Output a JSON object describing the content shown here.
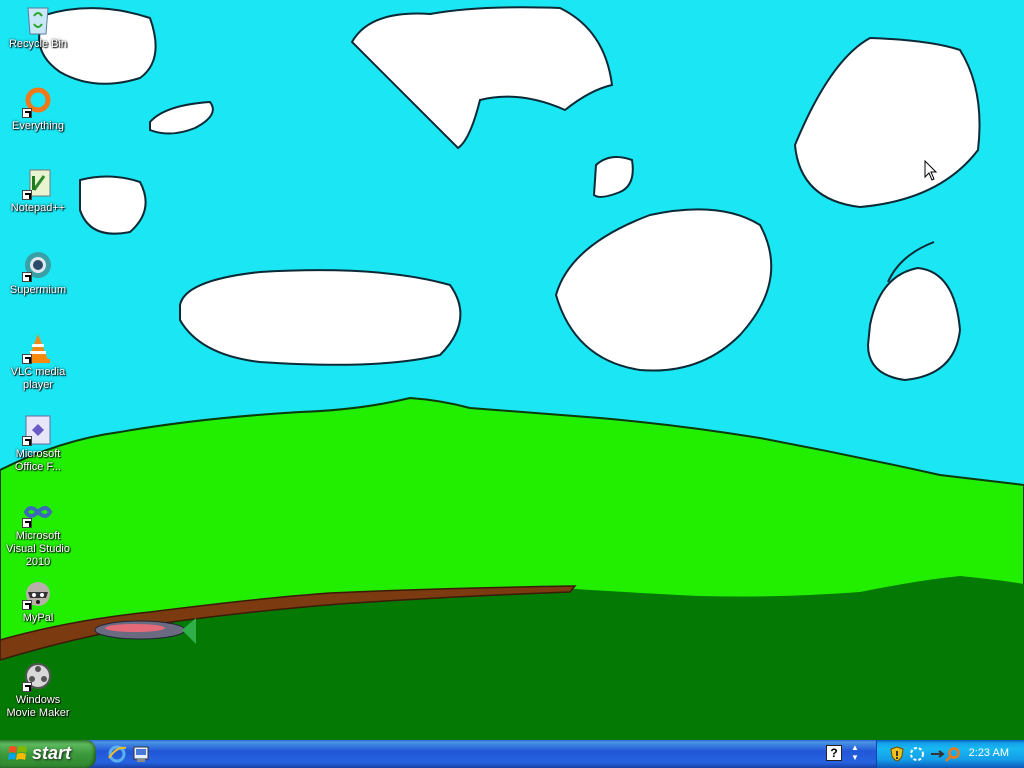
{
  "desktop": {
    "icons": [
      {
        "label": "Recycle Bin",
        "icon": "recycle-bin-icon"
      },
      {
        "label": "Everything",
        "icon": "everything-search-icon"
      },
      {
        "label": "Notepad++",
        "icon": "notepad-plus-plus-icon"
      },
      {
        "label": "Supermium",
        "icon": "supermium-browser-icon"
      },
      {
        "label": "VLC media player",
        "icon": "vlc-cone-icon"
      },
      {
        "label": "Microsoft Office F...",
        "icon": "office-document-icon"
      },
      {
        "label": "Microsoft Visual Studio 2010",
        "icon": "visual-studio-infinity-icon"
      },
      {
        "label": "MyPal",
        "icon": "mypal-raccoon-icon"
      },
      {
        "label": "Windows Movie Maker",
        "icon": "movie-maker-film-icon"
      }
    ],
    "wallpaper": {
      "sky": "#1ae6f4",
      "hill": "#22ee00",
      "ground": "#047a04",
      "path": "#7b3a10",
      "cloud": "#ffffff"
    }
  },
  "taskbar": {
    "start_label": "start",
    "quick_launch": [
      "internet-explorer-icon",
      "show-desktop-icon"
    ],
    "help_label": "?",
    "tray_expand_label": "▲\n▼",
    "tray_icons": [
      "security-shield-icon",
      "network-icon",
      "volume-icon",
      "search-icon"
    ],
    "clock": "2:23 AM",
    "colors": {
      "bar": "#2663e0",
      "start": "#3a9a3a",
      "tray": "#139ee9"
    }
  }
}
